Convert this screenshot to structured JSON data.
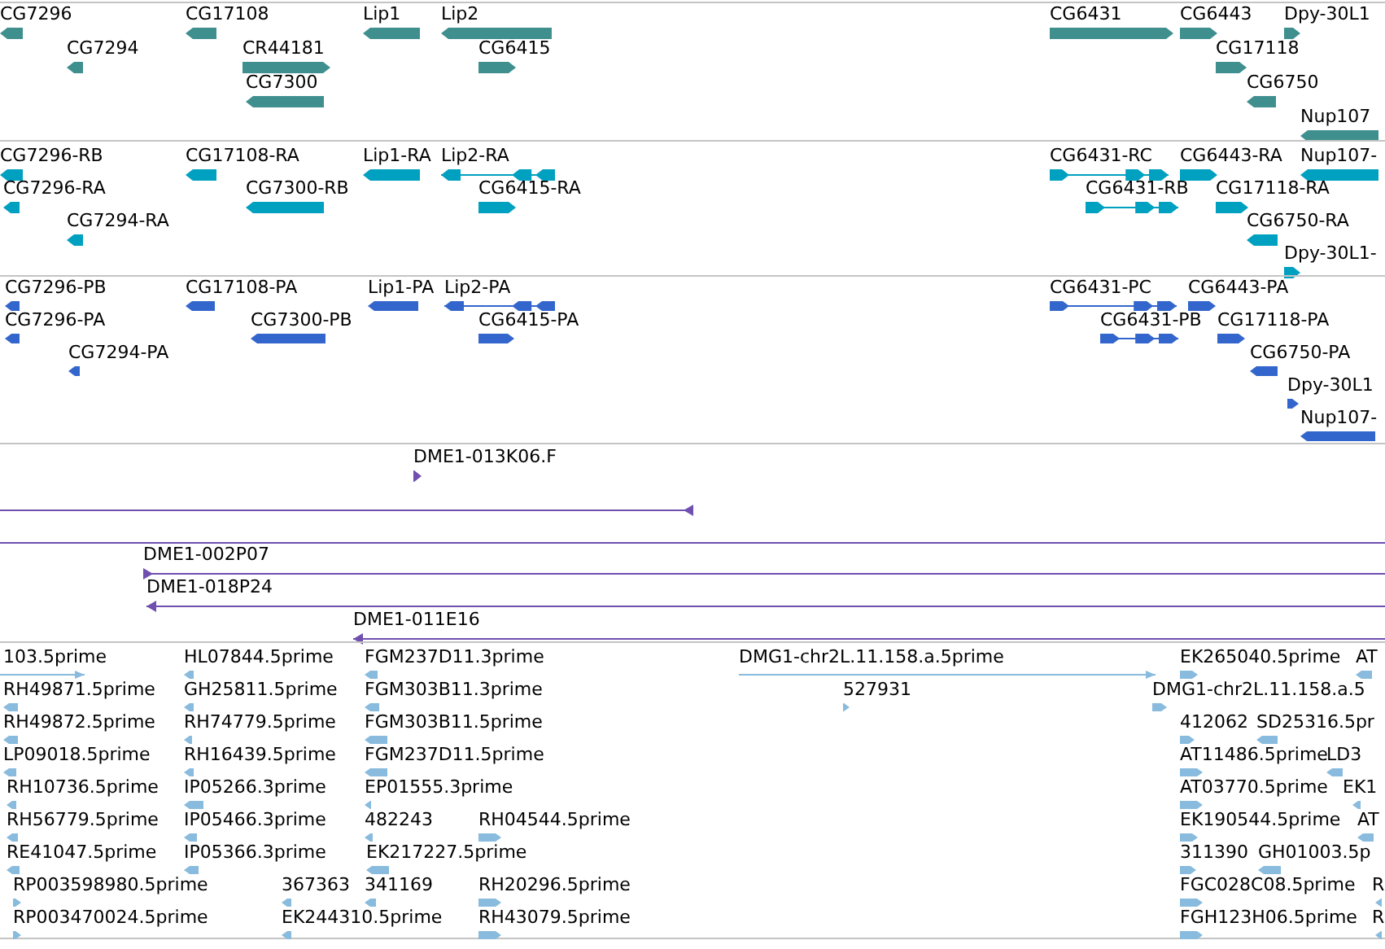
{
  "tracks": [
    {
      "kind": "gene",
      "color": "#3f8f8f",
      "features": [
        {
          "label": "CG7296",
          "reverse": true
        },
        {
          "label": "CG17108",
          "reverse": true
        },
        {
          "label": "Lip1",
          "reverse": true
        },
        {
          "label": "Lip2",
          "reverse": true
        },
        {
          "label": "CG6431",
          "reverse": false
        },
        {
          "label": "CG6443",
          "reverse": false
        },
        {
          "label": "Dpy-30L1",
          "reverse": false
        },
        {
          "label": "CG7294",
          "reverse": true
        },
        {
          "label": "CR44181",
          "reverse": false
        },
        {
          "label": "CG6415",
          "reverse": false
        },
        {
          "label": "CG17118",
          "reverse": false
        },
        {
          "label": "CG7300",
          "reverse": true
        },
        {
          "label": "CG6750",
          "reverse": true
        },
        {
          "label": "Nup107",
          "reverse": true
        }
      ]
    },
    {
      "kind": "mrna",
      "color": "#00a0c0",
      "features": [
        {
          "label": "CG7296-RB",
          "reverse": true
        },
        {
          "label": "CG17108-RA",
          "reverse": true
        },
        {
          "label": "Lip1-RA",
          "reverse": true
        },
        {
          "label": "Lip2-RA",
          "reverse": true
        },
        {
          "label": "CG6431-RC",
          "reverse": false
        },
        {
          "label": "CG6443-RA",
          "reverse": false
        },
        {
          "label": "Nup107-",
          "reverse": true
        },
        {
          "label": "CG7296-RA",
          "reverse": true
        },
        {
          "label": "CG7300-RB",
          "reverse": true
        },
        {
          "label": "CG6415-RA",
          "reverse": false
        },
        {
          "label": "CG6431-RB",
          "reverse": false
        },
        {
          "label": "CG17118-RA",
          "reverse": false
        },
        {
          "label": "CG7294-RA",
          "reverse": true
        },
        {
          "label": "CG6750-RA",
          "reverse": true
        },
        {
          "label": "Dpy-30L1-",
          "reverse": false
        }
      ]
    },
    {
      "kind": "protein",
      "color": "#3366cc",
      "features": [
        {
          "label": "CG7296-PB",
          "reverse": true
        },
        {
          "label": "CG17108-PA",
          "reverse": true
        },
        {
          "label": "Lip1-PA",
          "reverse": true
        },
        {
          "label": "Lip2-PA",
          "reverse": true
        },
        {
          "label": "CG6431-PC",
          "reverse": false
        },
        {
          "label": "CG6443-PA",
          "reverse": false
        },
        {
          "label": "CG7296-PA",
          "reverse": true
        },
        {
          "label": "CG7300-PB",
          "reverse": true
        },
        {
          "label": "CG6415-PA",
          "reverse": false
        },
        {
          "label": "CG6431-PB",
          "reverse": false
        },
        {
          "label": "CG17118-PA",
          "reverse": false
        },
        {
          "label": "CG7294-PA",
          "reverse": true
        },
        {
          "label": "CG6750-PA",
          "reverse": true
        },
        {
          "label": "Dpy-30L1",
          "reverse": false
        },
        {
          "label": "Nup107-",
          "reverse": true
        }
      ]
    },
    {
      "kind": "bac",
      "color": "#6f4fb0",
      "features": [
        {
          "kind": "arrow",
          "label": "DME1-013K06.F",
          "reverse": false
        },
        {
          "kind": "arrow",
          "reverse": true
        },
        {
          "kind": "line"
        },
        {
          "kind": "arrow",
          "label": "DME1-002P07",
          "reverse": false
        },
        {
          "kind": "arrow",
          "label": "DME1-018P24",
          "reverse": true
        },
        {
          "kind": "arrow",
          "label": "DME1-011E16",
          "reverse": true
        }
      ]
    },
    {
      "kind": "est",
      "color": "#88bbdd",
      "features": [
        {
          "label": "103.5prime",
          "reverse": false
        },
        {
          "label": "HL07844.5prime",
          "reverse": true
        },
        {
          "label": "FGM237D11.3prime",
          "reverse": true
        },
        {
          "label": "DMG1-chr2L.11.158.a.5prime",
          "reverse": false
        },
        {
          "label": "EK265040.5prime",
          "reverse": false
        },
        {
          "label": "AT",
          "reverse": true
        },
        {
          "label": "RH49871.5prime",
          "reverse": true
        },
        {
          "label": "GH25811.5prime",
          "reverse": true
        },
        {
          "label": "FGM303B11.3prime",
          "reverse": true
        },
        {
          "label": "527931",
          "reverse": false
        },
        {
          "label": "DMG1-chr2L.11.158.a.5",
          "reverse": false
        },
        {
          "label": "RH49872.5prime",
          "reverse": true
        },
        {
          "label": "RH74779.5prime",
          "reverse": true
        },
        {
          "label": "FGM303B11.5prime",
          "reverse": true
        },
        {
          "label": "412062",
          "reverse": false
        },
        {
          "label": "SD25316.5pr",
          "reverse": true
        },
        {
          "label": "LP09018.5prime",
          "reverse": true
        },
        {
          "label": "RH16439.5prime",
          "reverse": true
        },
        {
          "label": "FGM237D11.5prime",
          "reverse": true
        },
        {
          "label": "AT11486.5prime",
          "reverse": false
        },
        {
          "label": "LD3",
          "reverse": true
        },
        {
          "label": "RH10736.5prime",
          "reverse": true
        },
        {
          "label": "IP05266.3prime",
          "reverse": true
        },
        {
          "label": "EP01555.3prime",
          "reverse": true
        },
        {
          "label": "AT03770.5prime",
          "reverse": false
        },
        {
          "label": "EK1",
          "reverse": true
        },
        {
          "label": "RH56779.5prime",
          "reverse": true
        },
        {
          "label": "IP05466.3prime",
          "reverse": true
        },
        {
          "label": "482243",
          "reverse": true
        },
        {
          "label": "RH04544.5prime",
          "reverse": false
        },
        {
          "label": "EK190544.5prime",
          "reverse": false
        },
        {
          "label": "AT",
          "reverse": true
        },
        {
          "label": "RE41047.5prime",
          "reverse": true
        },
        {
          "label": "IP05366.3prime",
          "reverse": true
        },
        {
          "label": "EK217227.5prime",
          "reverse": true
        },
        {
          "label": "311390",
          "reverse": false
        },
        {
          "label": "GH01003.5p",
          "reverse": true
        },
        {
          "label": "RP003598980.5prime",
          "reverse": false
        },
        {
          "label": "367363",
          "reverse": true
        },
        {
          "label": "341169",
          "reverse": true
        },
        {
          "label": "RH20296.5prime",
          "reverse": false
        },
        {
          "label": "FGC028C08.5prime",
          "reverse": false
        },
        {
          "label": "R",
          "reverse": true
        },
        {
          "label": "RP003470024.5prime",
          "reverse": false
        },
        {
          "label": "EK244310.5prime",
          "reverse": true
        },
        {
          "label": "RH43079.5prime",
          "reverse": false
        },
        {
          "label": "FGH123H06.5prime",
          "reverse": false
        },
        {
          "label": "R",
          "reverse": true
        }
      ]
    }
  ]
}
